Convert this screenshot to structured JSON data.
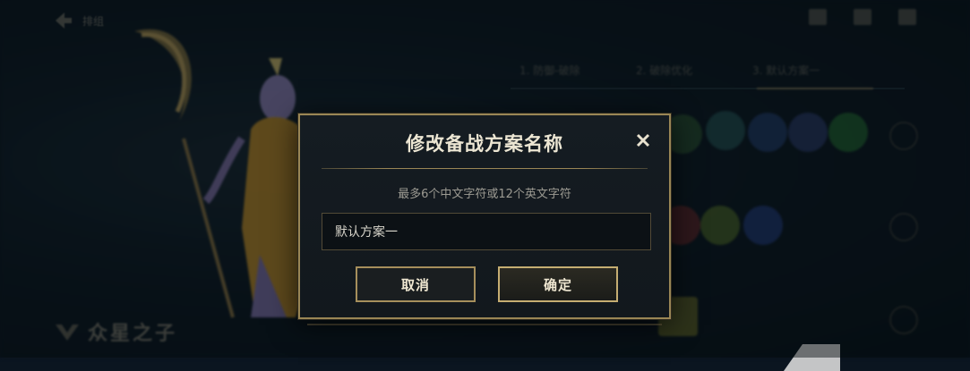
{
  "background": {
    "back_label": "排组",
    "tabs": [
      "1. 防御-破除",
      "2. 破除优化",
      "3. 默认方案一"
    ],
    "champion_name": "众星之子"
  },
  "dialog": {
    "title": "修改备战方案名称",
    "hint": "最多6个中文字符或12个英文字符",
    "input_value": "默认方案一",
    "cancel_label": "取消",
    "confirm_label": "确定"
  },
  "colors": {
    "gold_border": "#9a8655",
    "modal_bg": "#151c22",
    "title_text": "#ece6d3"
  }
}
